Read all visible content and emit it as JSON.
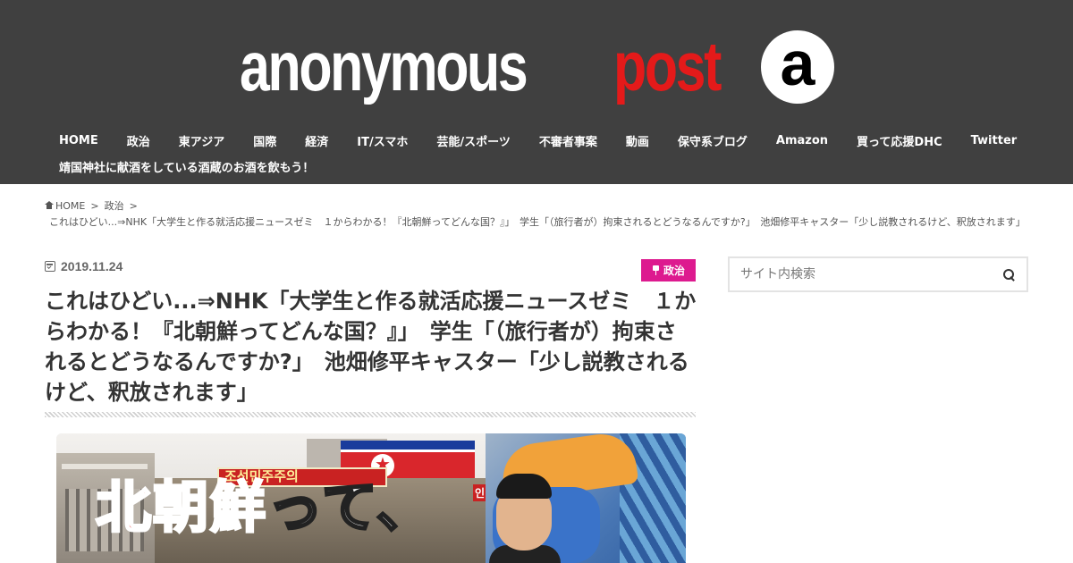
{
  "site": {
    "logo_word1": "anonymous",
    "logo_word2": "post",
    "logo_mark": "a",
    "colors": {
      "header_bg": "#404040",
      "logo_accent": "#e41a1a",
      "category_badge": "#dd1a8f"
    }
  },
  "nav": {
    "items": [
      {
        "label": "HOME"
      },
      {
        "label": "政治"
      },
      {
        "label": "東アジア"
      },
      {
        "label": "国際"
      },
      {
        "label": "経済"
      },
      {
        "label": "IT/スマホ"
      },
      {
        "label": "芸能/スポーツ"
      },
      {
        "label": "不審者事案"
      },
      {
        "label": "動画"
      },
      {
        "label": "保守系ブログ"
      },
      {
        "label": "Amazon"
      },
      {
        "label": "買って応援DHC"
      },
      {
        "label": "Twitter"
      },
      {
        "label": "靖国神社に献酒をしている酒蔵のお酒を飲もう！"
      }
    ]
  },
  "breadcrumb": {
    "home": "HOME",
    "category": "政治",
    "separator": ">",
    "current": "これはひどい...⇒NHK「大学生と作る就活応援ニュースゼミ　１からわかる！『北朝鮮ってどんな国？』」　学生「（旅行者が）拘束されるとどうなるんですか?」　池畑修平キャスター「少し説教されるけど、釈放されます」"
  },
  "article": {
    "date": "2019.11.24",
    "category": "政治",
    "title": "これはひどい...⇒NHK「大学生と作る就活応援ニュースゼミ　１からわかる！『北朝鮮ってどんな国？』」　学生「（旅行者が）拘束されるとどうなるんですか?」　池畑修平キャスター「少し説教されるけど、釈放されます」",
    "image": {
      "banner_text": "조선민주주의",
      "corner_text": "인",
      "headline_red": "北朝鮮",
      "headline_white": "って、"
    }
  },
  "sidebar": {
    "search_placeholder": "サイト内検索"
  }
}
